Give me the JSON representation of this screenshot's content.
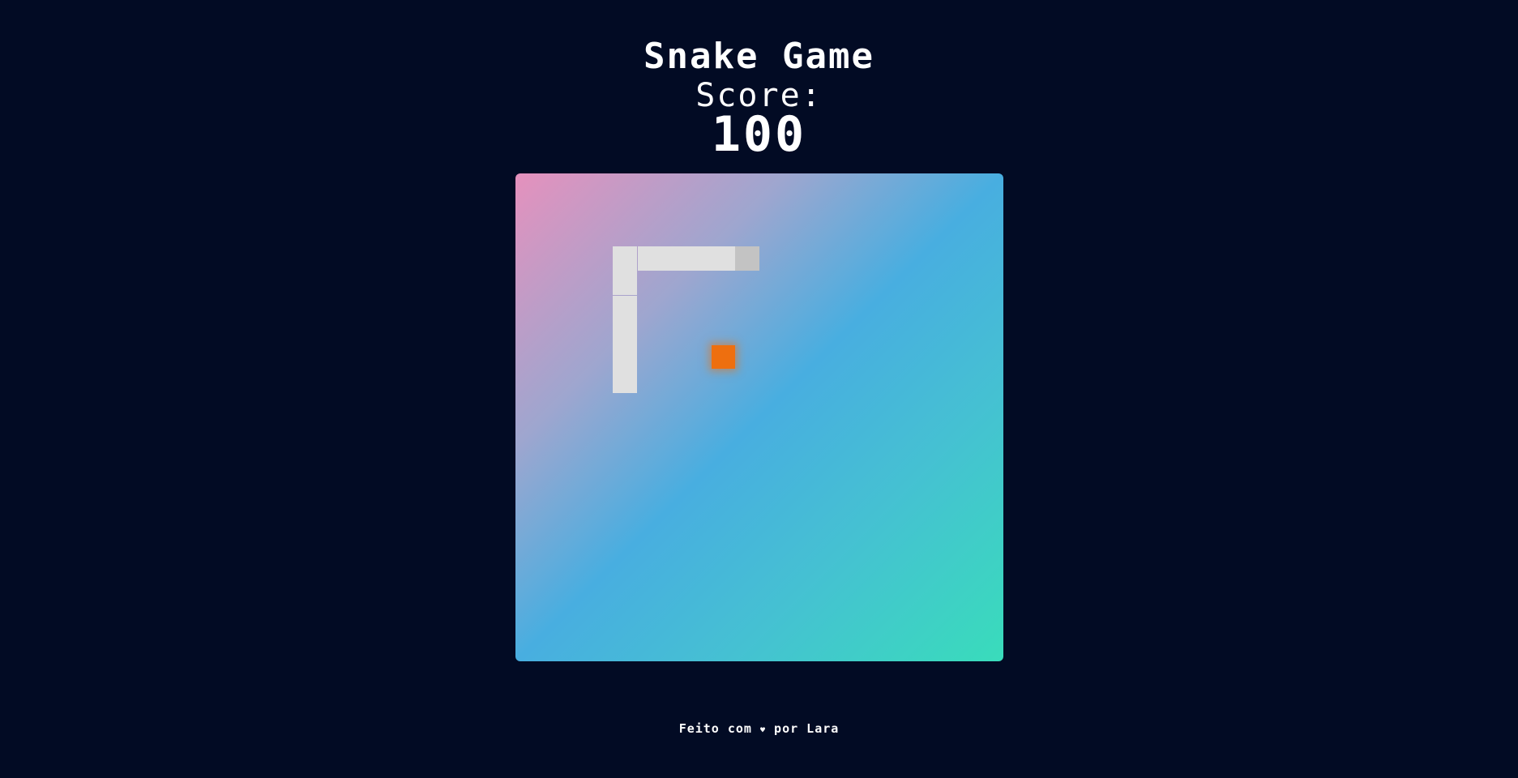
{
  "header": {
    "title": "Snake Game",
    "score_label": "Score:",
    "score_value": "100"
  },
  "board": {
    "grid_columns": 20,
    "grid_rows": 20,
    "snake_color": "#e0e0e0",
    "snake_head_color": "#c3c3c3",
    "food_color": "#ee6f0f",
    "gradient_colors": [
      "#e591bd",
      "#48aee0",
      "#39dcbb"
    ],
    "snake": [
      {
        "col": 9,
        "row": 3
      },
      {
        "col": 8,
        "row": 3
      },
      {
        "col": 7,
        "row": 3
      },
      {
        "col": 6,
        "row": 3
      },
      {
        "col": 5,
        "row": 3
      },
      {
        "col": 4,
        "row": 3
      },
      {
        "col": 4,
        "row": 4
      },
      {
        "col": 4,
        "row": 5
      },
      {
        "col": 4,
        "row": 6
      },
      {
        "col": 4,
        "row": 7
      },
      {
        "col": 4,
        "row": 8
      }
    ],
    "food": {
      "col": 8,
      "row": 7
    }
  },
  "footer": {
    "text_before": "Feito com ",
    "heart": "♥",
    "text_after": " por Lara"
  },
  "colors": {
    "background": "#020b24",
    "text": "#ffffff"
  }
}
